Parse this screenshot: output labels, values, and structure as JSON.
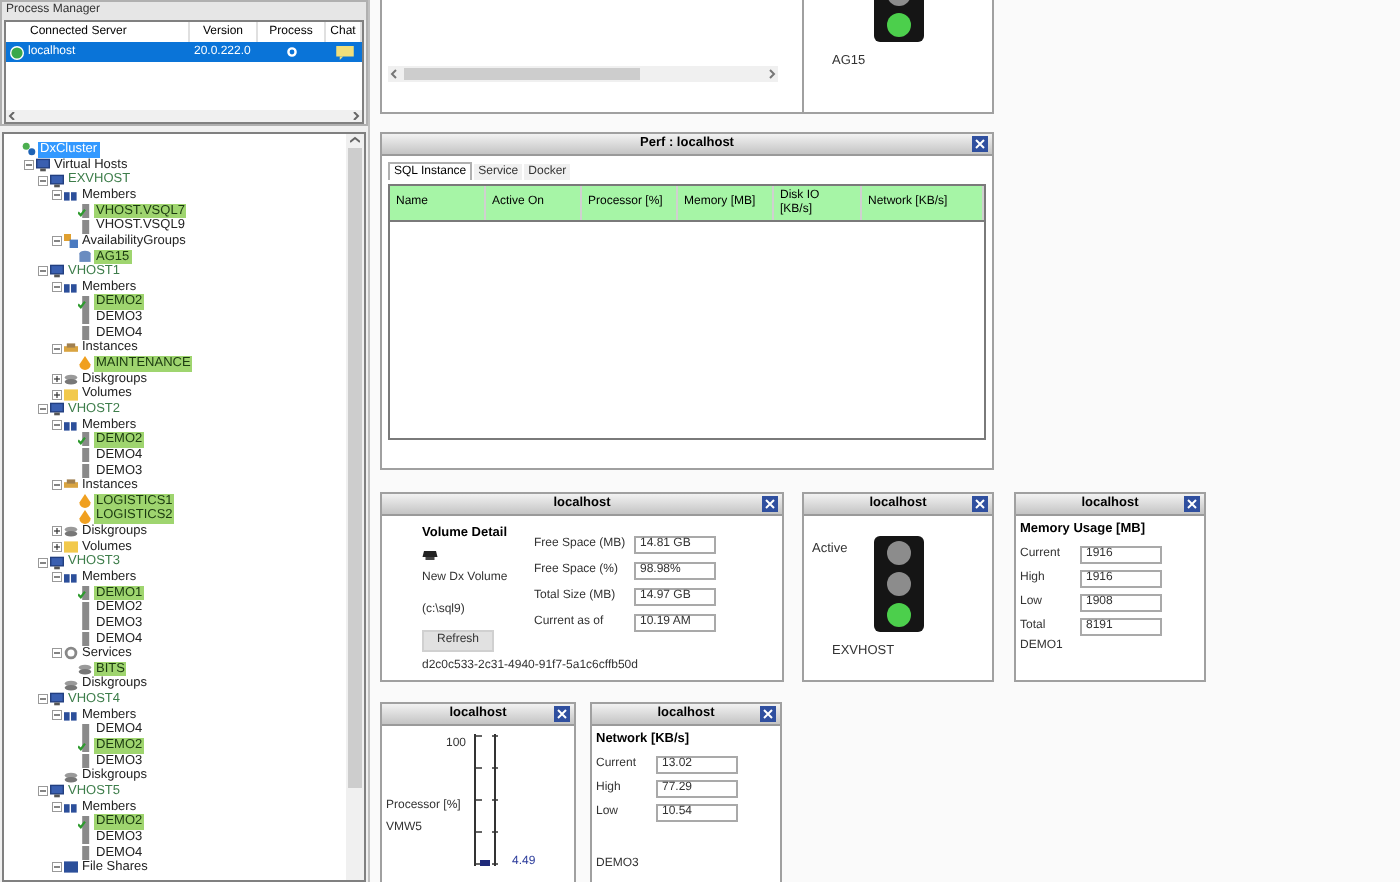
{
  "process_manager": {
    "title": "Process Manager",
    "columns": [
      "Connected Server",
      "Version",
      "Process",
      "Chat"
    ],
    "rows": [
      {
        "server": "localhost",
        "version": "20.0.222.0",
        "selected": true
      }
    ]
  },
  "tree": {
    "items": [
      {
        "label": "DxCluster",
        "kind": "root",
        "selected": true,
        "children": [
          {
            "label": "Virtual Hosts",
            "kind": "hosts",
            "selected": false,
            "active": false,
            "expanded": true,
            "children": [
              {
                "label": "EXVHOST",
                "kind": "host",
                "selected": false,
                "active": false,
                "expanded": true,
                "children": [
                  {
                    "label": "Members",
                    "kind": "members",
                    "selected": false,
                    "active": false,
                    "expanded": true,
                    "children": [
                      {
                        "label": "VHOST.VSQL7",
                        "kind": "server",
                        "selected": false,
                        "active": true
                      },
                      {
                        "label": "VHOST.VSQL9",
                        "kind": "server",
                        "selected": false,
                        "active": false
                      }
                    ]
                  },
                  {
                    "label": "AvailabilityGroups",
                    "kind": "ags",
                    "selected": false,
                    "active": false,
                    "expanded": true,
                    "children": [
                      {
                        "label": "AG15",
                        "kind": "ag",
                        "selected": false,
                        "active": true
                      }
                    ]
                  }
                ]
              },
              {
                "label": "VHOST1",
                "kind": "host",
                "selected": false,
                "active": false,
                "expanded": true,
                "children": [
                  {
                    "label": "Members",
                    "kind": "members",
                    "selected": false,
                    "active": false,
                    "expanded": true,
                    "children": [
                      {
                        "label": "DEMO2",
                        "kind": "server",
                        "selected": false,
                        "active": true
                      },
                      {
                        "label": "DEMO3",
                        "kind": "server",
                        "selected": false,
                        "active": false
                      },
                      {
                        "label": "DEMO4",
                        "kind": "server",
                        "selected": false,
                        "active": false
                      }
                    ]
                  },
                  {
                    "label": "Instances",
                    "kind": "instances",
                    "selected": false,
                    "active": false,
                    "expanded": true,
                    "children": [
                      {
                        "label": "MAINTENANCE",
                        "kind": "instance",
                        "selected": false,
                        "active": true
                      }
                    ]
                  },
                  {
                    "label": "Diskgroups",
                    "kind": "diskgroups",
                    "selected": false,
                    "active": false,
                    "expanded": false
                  },
                  {
                    "label": "Volumes",
                    "kind": "volumes",
                    "selected": false,
                    "active": false,
                    "expanded": false
                  }
                ]
              },
              {
                "label": "VHOST2",
                "kind": "host",
                "selected": false,
                "active": false,
                "expanded": true,
                "children": [
                  {
                    "label": "Members",
                    "kind": "members",
                    "selected": false,
                    "active": false,
                    "expanded": true,
                    "children": [
                      {
                        "label": "DEMO2",
                        "kind": "server",
                        "selected": false,
                        "active": true
                      },
                      {
                        "label": "DEMO4",
                        "kind": "server",
                        "selected": false,
                        "active": false
                      },
                      {
                        "label": "DEMO3",
                        "kind": "server",
                        "selected": false,
                        "active": false
                      }
                    ]
                  },
                  {
                    "label": "Instances",
                    "kind": "instances",
                    "selected": false,
                    "active": false,
                    "expanded": true,
                    "children": [
                      {
                        "label": "LOGISTICS1",
                        "kind": "instance",
                        "selected": false,
                        "active": true
                      },
                      {
                        "label": "LOGISTICS2",
                        "kind": "instance",
                        "selected": false,
                        "active": true
                      }
                    ]
                  },
                  {
                    "label": "Diskgroups",
                    "kind": "diskgroups",
                    "selected": false,
                    "active": false,
                    "expanded": false
                  },
                  {
                    "label": "Volumes",
                    "kind": "volumes",
                    "selected": false,
                    "active": false,
                    "expanded": false
                  }
                ]
              },
              {
                "label": "VHOST3",
                "kind": "host",
                "selected": false,
                "active": false,
                "expanded": true,
                "children": [
                  {
                    "label": "Members",
                    "kind": "members",
                    "selected": false,
                    "active": false,
                    "expanded": true,
                    "children": [
                      {
                        "label": "DEMO1",
                        "kind": "server",
                        "selected": false,
                        "active": true
                      },
                      {
                        "label": "DEMO2",
                        "kind": "server",
                        "selected": false,
                        "active": false
                      },
                      {
                        "label": "DEMO3",
                        "kind": "server",
                        "selected": false,
                        "active": false
                      },
                      {
                        "label": "DEMO4",
                        "kind": "server",
                        "selected": false,
                        "active": false
                      }
                    ]
                  },
                  {
                    "label": "Services",
                    "kind": "services",
                    "selected": false,
                    "active": false,
                    "expanded": true,
                    "children": [
                      {
                        "label": "BITS",
                        "kind": "service",
                        "selected": false,
                        "active": true
                      }
                    ]
                  },
                  {
                    "label": "Diskgroups",
                    "kind": "diskgroups",
                    "selected": false,
                    "active": false
                  }
                ]
              },
              {
                "label": "VHOST4",
                "kind": "host",
                "selected": false,
                "active": false,
                "expanded": true,
                "children": [
                  {
                    "label": "Members",
                    "kind": "members",
                    "selected": false,
                    "active": false,
                    "expanded": true,
                    "children": [
                      {
                        "label": "DEMO4",
                        "kind": "server",
                        "selected": false,
                        "active": false
                      },
                      {
                        "label": "DEMO2",
                        "kind": "server",
                        "selected": false,
                        "active": true
                      },
                      {
                        "label": "DEMO3",
                        "kind": "server",
                        "selected": false,
                        "active": false
                      }
                    ]
                  },
                  {
                    "label": "Diskgroups",
                    "kind": "diskgroups",
                    "selected": false,
                    "active": false
                  }
                ]
              },
              {
                "label": "VHOST5",
                "kind": "host",
                "selected": false,
                "active": false,
                "expanded": true,
                "children": [
                  {
                    "label": "Members",
                    "kind": "members",
                    "selected": false,
                    "active": false,
                    "expanded": true,
                    "children": [
                      {
                        "label": "DEMO2",
                        "kind": "server",
                        "selected": false,
                        "active": true
                      },
                      {
                        "label": "DEMO3",
                        "kind": "server",
                        "selected": false,
                        "active": false
                      },
                      {
                        "label": "DEMO4",
                        "kind": "server",
                        "selected": false,
                        "active": false
                      }
                    ]
                  },
                  {
                    "label": "File Shares",
                    "kind": "fileshares",
                    "selected": false,
                    "active": false,
                    "expanded": true
                  }
                ]
              }
            ]
          }
        ]
      }
    ]
  },
  "panels": [
    {
      "kind": "grid"
    },
    {
      "kind": "traffic",
      "lights": [
        {
          "on": false
        },
        {
          "on": true
        }
      ],
      "label": "AG15"
    },
    {
      "kind": "perf",
      "title": "Perf : localhost",
      "tabs": [
        {
          "label": "SQL Instance",
          "selected": true
        },
        {
          "label": "Service",
          "selected": false
        },
        {
          "label": "Docker",
          "selected": false
        }
      ],
      "columns": [
        "Name",
        "Active On",
        "Processor [%]",
        "Memory [MB]",
        "Disk IO [KB/s]",
        "Network [KB/s]"
      ]
    },
    {
      "kind": "volume",
      "title": "localhost",
      "heading": "Volume Detail",
      "name": "New Dx Volume",
      "path": "(c:\\sql9)",
      "button": "Refresh",
      "guid": "d2c0c533-2c31-4940-91f7-5a1c6cffb50d",
      "fields": [
        {
          "label": "Free Space (MB)",
          "value": "14.81 GB"
        },
        {
          "label": "Free Space (%)",
          "value": "98.98%"
        },
        {
          "label": "Total Size (MB)",
          "value": "14.97 GB"
        },
        {
          "label": "Current as of",
          "value": "10.19 AM"
        }
      ]
    },
    {
      "kind": "traffic",
      "title": "localhost",
      "status": "Active",
      "lights": [
        {
          "on": false
        },
        {
          "on": false
        },
        {
          "on": true
        }
      ],
      "label": "EXVHOST"
    },
    {
      "kind": "stats",
      "title": "localhost",
      "heading": "Memory Usage [MB]",
      "fields": [
        {
          "label": "Current",
          "value": "1916"
        },
        {
          "label": "High",
          "value": "1916"
        },
        {
          "label": "Low",
          "value": "1908"
        },
        {
          "label": "Total",
          "value": "8191"
        }
      ],
      "footer": "DEMO1"
    },
    {
      "kind": "gauge",
      "title": "localhost",
      "max": "100",
      "label": "Processor [%]",
      "host": "VMW5",
      "level": 0.0449,
      "reading": "4.49"
    },
    {
      "kind": "stats",
      "title": "localhost",
      "heading": "Network [KB/s]",
      "fields": [
        {
          "label": "Current",
          "value": "13.02"
        },
        {
          "label": "High",
          "value": "77.29"
        },
        {
          "label": "Low",
          "value": "10.54"
        }
      ],
      "footer": "DEMO3"
    }
  ]
}
